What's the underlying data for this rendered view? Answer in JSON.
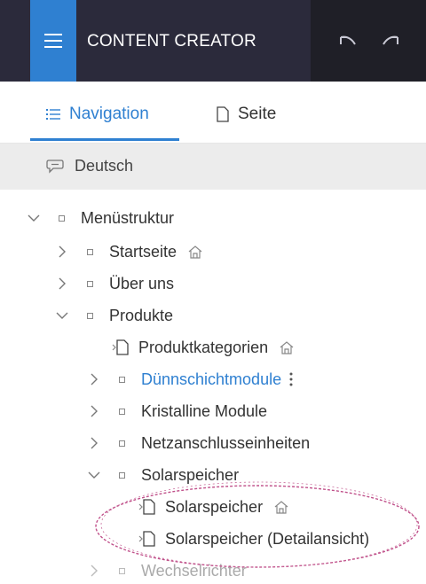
{
  "app": {
    "title": "CONTENT CREATOR"
  },
  "tabs": [
    {
      "label": "Navigation",
      "active": true
    },
    {
      "label": "Seite",
      "active": false
    }
  ],
  "language": {
    "label": "Deutsch"
  },
  "tree": {
    "root": "Menüstruktur",
    "items": [
      {
        "label": "Startseite"
      },
      {
        "label": "Über uns"
      },
      {
        "label": "Produkte"
      },
      {
        "label": "Produktkategorien"
      },
      {
        "label": "Dünnschichtmodule"
      },
      {
        "label": "Kristalline Module"
      },
      {
        "label": "Netzanschlusseinheiten"
      },
      {
        "label": "Solarspeicher"
      },
      {
        "label": "Solarspeicher"
      },
      {
        "label": "Solarspeicher (Detailansicht)"
      },
      {
        "label": "Wechselrichter"
      }
    ]
  },
  "colors": {
    "accent": "#2f80d1",
    "topbar": "#2b2a3b",
    "annotation": "#c0508a"
  }
}
